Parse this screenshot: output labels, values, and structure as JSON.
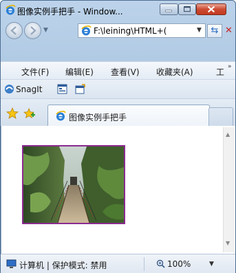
{
  "window": {
    "title": "图像实例手把手 - Window..."
  },
  "address": {
    "url": "F:\\leining\\HTML+("
  },
  "menu": {
    "items": [
      "文件(F)",
      "编辑(E)",
      "查看(V)",
      "收藏夹(A)",
      "工"
    ],
    "more": "»"
  },
  "linkbar": {
    "snagit_label": "SnagIt"
  },
  "tab": {
    "title": "图像实例手把手"
  },
  "statusbar": {
    "zone_text": "计算机 | 保护模式: 禁用",
    "zoom": "100%"
  },
  "colors": {
    "photo_border": "#8b2a8f",
    "title_bar": "#bcd3ea",
    "close_button": "#cc4b32"
  },
  "icons": [
    "ie-icon",
    "minimize-icon",
    "maximize-icon",
    "close-icon",
    "back-icon",
    "forward-icon",
    "refresh-icon",
    "stop-icon",
    "snagit-icon",
    "favorites-star-icon",
    "add-favorites-icon",
    "computer-icon",
    "zoom-icon"
  ]
}
